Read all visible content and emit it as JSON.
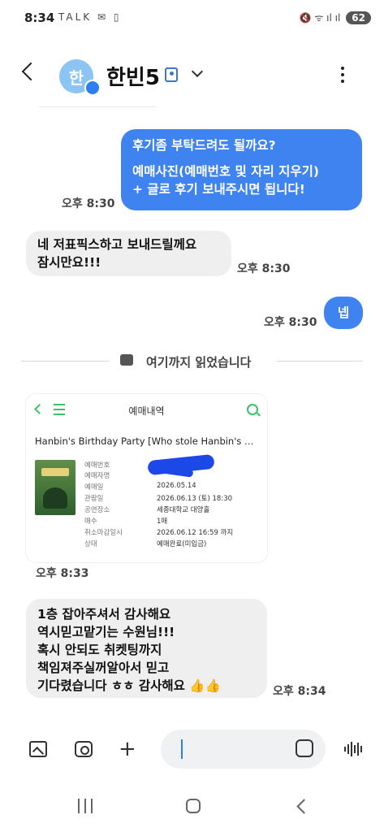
{
  "status_bar": {
    "time": "8:34",
    "left_icons": "TALK ✉ ▯",
    "right_icons": "🔇 ᯤ ıl ıl",
    "battery": "62"
  },
  "header": {
    "avatar_initial": "한",
    "contact_name": "한빈5"
  },
  "messages": [
    {
      "id": "m1",
      "direction": "out",
      "lines": [
        "후기좀 부탁드려도 될까요?",
        "",
        "예매사진(예매번호 및 자리  지우기)",
        "+ 글로 후기 보내주시면 됩니다!"
      ],
      "time": "오후 8:30"
    },
    {
      "id": "m2",
      "direction": "in",
      "lines": [
        "네 저표픽스하고 보내드릴께요",
        "잠시만요!!!"
      ],
      "time": "오후 8:30"
    },
    {
      "id": "m3",
      "direction": "out",
      "lines": [
        "넵"
      ],
      "time": "오후 8:30"
    }
  ],
  "read_marker": "여기까지 읽었습니다",
  "shared_image": {
    "page_title": "예매내역",
    "event_title": "Hanbin's Birthday Party [Who stole Hanbin's …",
    "rows": [
      {
        "label": "예매번호",
        "value": "M"
      },
      {
        "label": "예매자명",
        "value": ""
      },
      {
        "label": "예매일",
        "value": "2026.05.14"
      },
      {
        "label": "관람일",
        "value": "2026.06.13 (토) 18:30"
      },
      {
        "label": "공연장소",
        "value": "세종대학교 대양홀"
      },
      {
        "label": "매수",
        "value": "1매"
      },
      {
        "label": "취소마감일시",
        "value": "2026.06.12 16:59 까지"
      },
      {
        "label": "상태",
        "value": "예매완료(미입금)"
      }
    ],
    "time": "오후 8:33"
  },
  "last_message": {
    "lines": [
      "1층 잡아주셔서 감사해요",
      "역시믿고맡기는 수원님!!!",
      "혹시 안되도 취켓팅까지",
      "책임져주실꺼알아서 믿고",
      "기다렸습니다 ㅎㅎ 감사해요 👍👍"
    ],
    "time": "오후 8:34"
  },
  "colors": {
    "outgoing_bubble": "#3f83f0",
    "incoming_bubble": "#efefef",
    "accent_green": "#3cc06a"
  }
}
